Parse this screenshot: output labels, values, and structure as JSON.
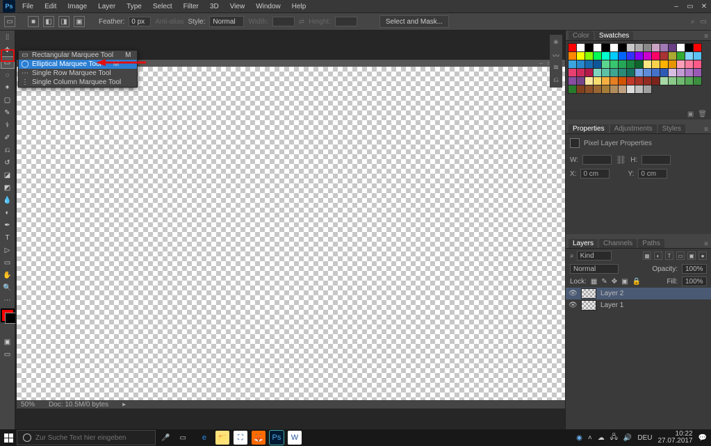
{
  "menubar": {
    "items": [
      "File",
      "Edit",
      "Image",
      "Layer",
      "Type",
      "Select",
      "Filter",
      "3D",
      "View",
      "Window",
      "Help"
    ]
  },
  "optionsbar": {
    "feather_label": "Feather:",
    "feather_value": "0 px",
    "anti_alias": "Anti-alias",
    "style_label": "Style:",
    "style_value": "Normal",
    "width_label": "Width:",
    "height_label": "Height:",
    "mask_button": "Select and Mask..."
  },
  "tool_flyout": {
    "items": [
      {
        "label": "Rectangular Marquee Tool",
        "key": "M"
      },
      {
        "label": "Elliptical Marquee Tool",
        "key": "M"
      },
      {
        "label": "Single Row Marquee Tool",
        "key": ""
      },
      {
        "label": "Single Column Marquee Tool",
        "key": ""
      }
    ]
  },
  "canvas": {
    "zoom": "50%",
    "doc_info": "Doc: 10.5M/0 bytes"
  },
  "right_panels": {
    "color_tab": "Color",
    "swatches_tab": "Swatches",
    "properties_tab": "Properties",
    "adjustments_tab": "Adjustments",
    "styles_tab": "Styles",
    "layers_tab": "Layers",
    "channels_tab": "Channels",
    "paths_tab": "Paths"
  },
  "swatches_colors": [
    "#ff0000",
    "#ffffff",
    "#000000",
    "#ffffff",
    "#000000",
    "#ffffff",
    "#000000",
    "#c8c8c8",
    "#aaaaaa",
    "#888888",
    "#caa2c4",
    "#a079b5",
    "#6a3e82",
    "#ffffff",
    "#000000",
    "#ff0000",
    "#ff8800",
    "#ffff00",
    "#88ff00",
    "#00ff55",
    "#00ffcc",
    "#00ccff",
    "#0066ff",
    "#3333ff",
    "#8800ff",
    "#cc00cc",
    "#ff0066",
    "#aa3333",
    "#aaaa33",
    "#33aa33",
    "#80d4ff",
    "#5cc1f2",
    "#3ba5e0",
    "#2788cc",
    "#166bb0",
    "#0d5699",
    "#5bd68f",
    "#37c76f",
    "#24a657",
    "#18863f",
    "#10652c",
    "#ffe680",
    "#ffd24d",
    "#ffb300",
    "#e69500",
    "#ffa0b8",
    "#ff7da0",
    "#ff5a88",
    "#e63f70",
    "#cc2b5c",
    "#b31a48",
    "#7ed6c0",
    "#5cc1a6",
    "#3ca690",
    "#2a8b78",
    "#176f5f",
    "#7aa5e6",
    "#5f8cd9",
    "#4572c9",
    "#2e5ab5",
    "#d7bde2",
    "#c39bd3",
    "#af7ac5",
    "#9b59b6",
    "#884ea0",
    "#76448a",
    "#f9e79f",
    "#f7dc6f",
    "#f5b041",
    "#e67e22",
    "#d35400",
    "#c0392b",
    "#a93226",
    "#922b21",
    "#7b241c",
    "#a7d8a5",
    "#8bc98a",
    "#6fba70",
    "#55a857",
    "#3c8f3f",
    "#2a7a2d",
    "#804020",
    "#8b5029",
    "#996633",
    "#a67c39",
    "#b38e5d",
    "#c0a080",
    "#dddddd",
    "#c0c0c0",
    "#a0a0a0"
  ],
  "properties": {
    "title": "Pixel Layer Properties",
    "w_label": "W:",
    "h_label": "H:",
    "x_label": "X:",
    "y_label": "Y:",
    "x_value": "0 cm",
    "y_value": "0 cm"
  },
  "layers": {
    "kind_label": "Kind",
    "blend": "Normal",
    "opacity_label": "Opacity:",
    "opacity": "100%",
    "lock_label": "Lock:",
    "fill_label": "Fill:",
    "fill": "100%",
    "items": [
      {
        "name": "Layer 2"
      },
      {
        "name": "Layer 1"
      }
    ]
  },
  "taskbar": {
    "search_placeholder": "Zur Suche Text hier eingeben",
    "time": "10:22",
    "date": "27.07.2017",
    "lang": "DEU"
  }
}
